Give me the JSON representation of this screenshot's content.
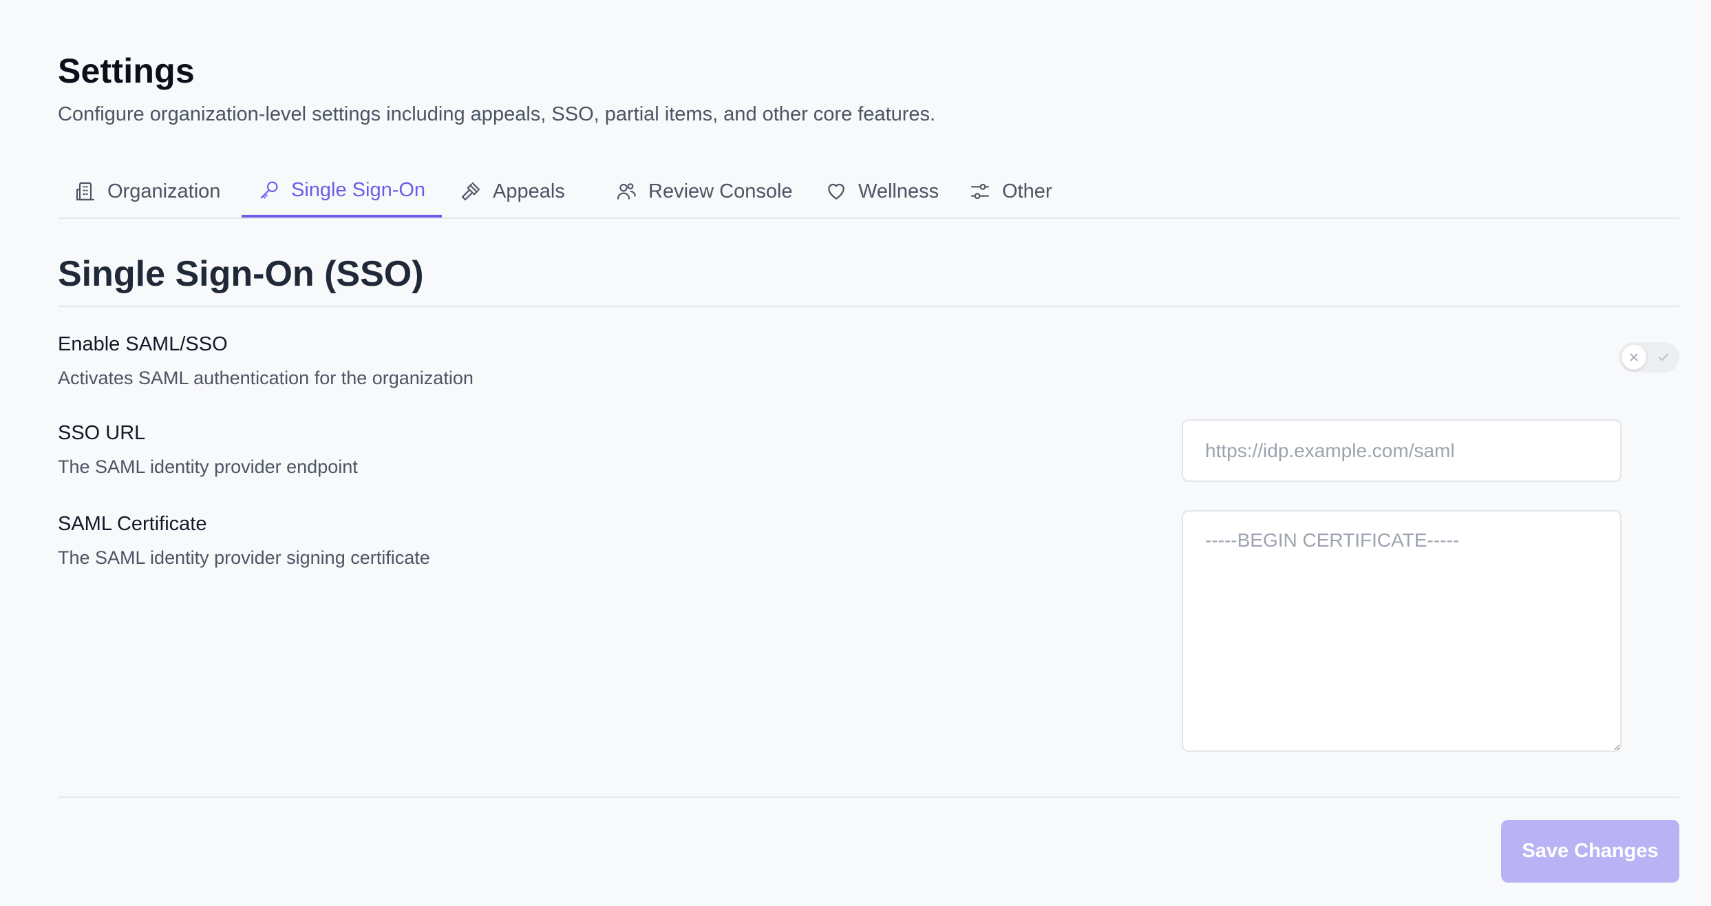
{
  "header": {
    "title": "Settings",
    "subtitle": "Configure organization-level settings including appeals, SSO, partial items, and other core features."
  },
  "tabs": [
    {
      "label": "Organization",
      "icon": "building-icon",
      "active": false
    },
    {
      "label": "Single Sign-On",
      "icon": "key-icon",
      "active": true
    },
    {
      "label": "Appeals",
      "icon": "gavel-icon",
      "active": false
    },
    {
      "label": "Review Console",
      "icon": "users-icon",
      "active": false
    },
    {
      "label": "Wellness",
      "icon": "heart-icon",
      "active": false
    },
    {
      "label": "Other",
      "icon": "sliders-icon",
      "active": false
    }
  ],
  "section": {
    "title": "Single Sign-On (SSO)"
  },
  "fields": {
    "saml_enabled": {
      "label": "Enable SAML/SSO",
      "description": "Activates SAML authentication for the organization",
      "value": false
    },
    "sso_url": {
      "label": "SSO URL",
      "description": "The SAML identity provider endpoint",
      "value": "",
      "placeholder": "https://idp.example.com/saml"
    },
    "saml_certificate": {
      "label": "SAML Certificate",
      "description": "The SAML identity provider signing certificate",
      "value": "",
      "placeholder": "-----BEGIN CERTIFICATE-----"
    }
  },
  "footer": {
    "save_label": "Save Changes"
  },
  "colors": {
    "accent": "#6c5ce7",
    "save_button_disabled": "#b9b3f6",
    "background": "#f8f9fb",
    "muted_text": "#4b5563",
    "placeholder": "#9ca3af"
  }
}
